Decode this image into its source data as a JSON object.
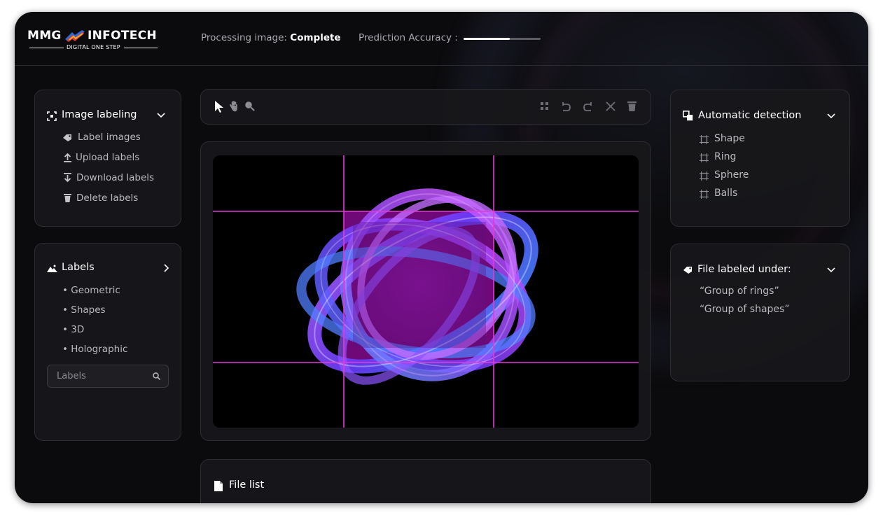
{
  "brand": {
    "name_left": "MMG",
    "name_right": "INFOTECH",
    "tagline": "DIGITAL ONE STEP"
  },
  "header": {
    "processing_label": "Processing image:",
    "processing_value": "Complete",
    "accuracy_label": "Prediction Accuracy :",
    "accuracy_fraction": 0.6
  },
  "image_labeling": {
    "title": "Image labeling",
    "items": [
      {
        "label": "Label images",
        "icon": "tag-icon"
      },
      {
        "label": "Upload labels",
        "icon": "upload-icon"
      },
      {
        "label": "Download labels",
        "icon": "download-icon"
      },
      {
        "label": "Delete labels",
        "icon": "trash-icon"
      }
    ]
  },
  "labels": {
    "title": "Labels",
    "items": [
      "• Geometric",
      "• Shapes",
      "• 3D",
      "• Holographic"
    ],
    "search_placeholder": "Labels"
  },
  "toolbar": {
    "left_tools": [
      "pointer-icon",
      "hand-icon",
      "zoom-icon"
    ],
    "right_tools": [
      "grid-icon",
      "undo-icon",
      "redo-icon",
      "close-icon",
      "trash-icon"
    ]
  },
  "file_list": {
    "title": "File list"
  },
  "automatic_detection": {
    "title": "Automatic detection",
    "items": [
      "Shape",
      "Ring",
      "Sphere",
      "Balls"
    ]
  },
  "file_labeled": {
    "title": "File labeled under:",
    "items": [
      "“Group of rings”",
      "“Group of shapes”"
    ]
  },
  "colors": {
    "accent_magenta": "#e33ad6",
    "ring_violet": "#8a3bff",
    "ring_blue": "#4a7bff",
    "panel_bg": "#18181b",
    "app_bg": "#0b0b0d"
  }
}
